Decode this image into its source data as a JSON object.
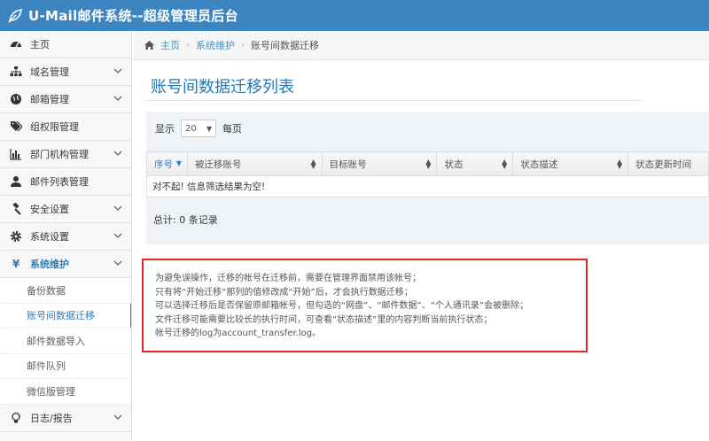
{
  "header": {
    "title": "U-Mail邮件系统--超级管理员后台",
    "logo_icon": "leaf-icon"
  },
  "sidebar": {
    "items": [
      {
        "label": "主页",
        "icon": "dashboard-icon",
        "has_chevron": false
      },
      {
        "label": "域名管理",
        "icon": "sitemap-icon",
        "has_chevron": true
      },
      {
        "label": "邮箱管理",
        "icon": "globe-icon",
        "has_chevron": true
      },
      {
        "label": "组权限管理",
        "icon": "tags-icon",
        "has_chevron": false
      },
      {
        "label": "部门机构管理",
        "icon": "bar-chart-icon",
        "has_chevron": true
      },
      {
        "label": "邮件列表管理",
        "icon": "user-icon",
        "has_chevron": false
      },
      {
        "label": "安全设置",
        "icon": "gavel-icon",
        "has_chevron": true
      },
      {
        "label": "系统设置",
        "icon": "gear-icon",
        "has_chevron": true
      },
      {
        "label": "系统维护",
        "icon": "yen-icon",
        "has_chevron": true,
        "active": true
      }
    ],
    "submenu": [
      "备份数据",
      "账号间数据迁移",
      "邮件数据导入",
      "邮件队列",
      "微信版管理"
    ],
    "active_submenu": "账号间数据迁移",
    "bottom_item": {
      "label": "日志/报告",
      "icon": "lightbulb-icon"
    }
  },
  "breadcrumb": {
    "home": "主页",
    "section": "系统维护",
    "current": "账号间数据迁移"
  },
  "page": {
    "title": "账号间数据迁移列表"
  },
  "table": {
    "length_prefix": "显示",
    "length_value": "20",
    "length_suffix": "每页",
    "columns": [
      "序号",
      "被迁移账号",
      "目标账号",
      "状态",
      "状态描述",
      "状态更新时间"
    ],
    "empty_message": "对不起! 信息筛选结果为空!",
    "summary": "总计: 0 条记录"
  },
  "notice": {
    "lines": [
      "为避免误操作，迁移的帐号在迁移前，需要在管理界面禁用该帐号；",
      "只有将“开始迁移”那列的值修改成“开始”后，才会执行数据迁移；",
      "可以选择迁移后是否保留原邮箱帐号，但勾选的“网盘”、“邮件数据”、“个人通讯录”会被删除；",
      "文件迁移可能需要比较长的执行时间，可查看“状态描述”里的内容判断当前执行状态；",
      "帐号迁移的log为account_transfer.log。"
    ]
  },
  "colors": {
    "header_bg": "#3d85c0",
    "accent": "#2b7dbc",
    "notice_border": "#e22626"
  }
}
